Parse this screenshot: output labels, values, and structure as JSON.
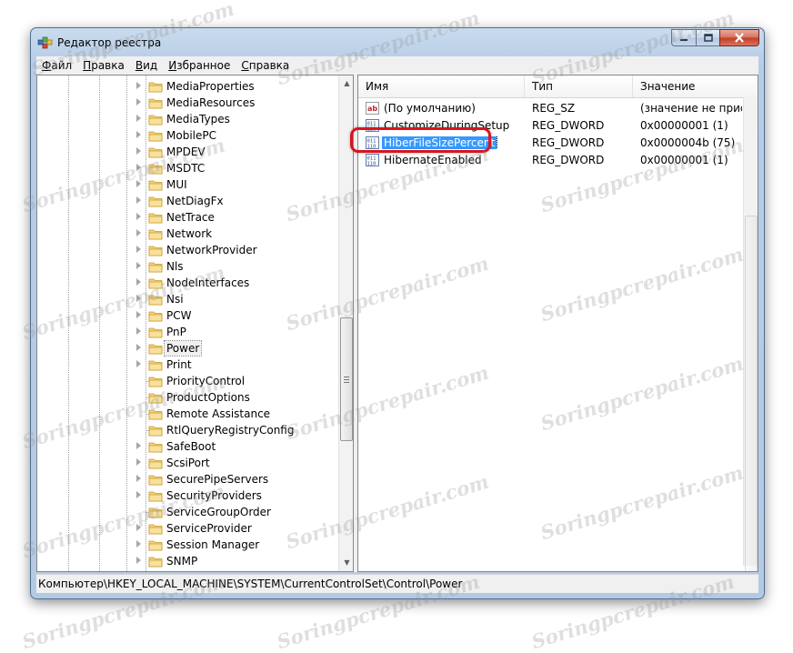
{
  "window": {
    "title": "Редактор реестра",
    "accent_color": "#b4cae3",
    "close_color": "#c43b22"
  },
  "menu": [
    "Файл",
    "Правка",
    "Вид",
    "Избранное",
    "Справка"
  ],
  "tree": {
    "items": [
      {
        "label": "MediaProperties",
        "expandable": true
      },
      {
        "label": "MediaResources",
        "expandable": true
      },
      {
        "label": "MediaTypes",
        "expandable": true
      },
      {
        "label": "MobilePC",
        "expandable": true
      },
      {
        "label": "MPDEV",
        "expandable": true
      },
      {
        "label": "MSDTC",
        "expandable": true
      },
      {
        "label": "MUI",
        "expandable": true
      },
      {
        "label": "NetDiagFx",
        "expandable": true
      },
      {
        "label": "NetTrace",
        "expandable": true
      },
      {
        "label": "Network",
        "expandable": true
      },
      {
        "label": "NetworkProvider",
        "expandable": true
      },
      {
        "label": "Nls",
        "expandable": true
      },
      {
        "label": "NodeInterfaces",
        "expandable": true
      },
      {
        "label": "Nsi",
        "expandable": true
      },
      {
        "label": "PCW",
        "expandable": true
      },
      {
        "label": "PnP",
        "expandable": true
      },
      {
        "label": "Power",
        "expandable": true,
        "selected": true
      },
      {
        "label": "Print",
        "expandable": true
      },
      {
        "label": "PriorityControl",
        "expandable": false
      },
      {
        "label": "ProductOptions",
        "expandable": false
      },
      {
        "label": "Remote Assistance",
        "expandable": false
      },
      {
        "label": "RtlQueryRegistryConfig",
        "expandable": false
      },
      {
        "label": "SafeBoot",
        "expandable": true
      },
      {
        "label": "ScsiPort",
        "expandable": true
      },
      {
        "label": "SecurePipeServers",
        "expandable": true
      },
      {
        "label": "SecurityProviders",
        "expandable": true
      },
      {
        "label": "ServiceGroupOrder",
        "expandable": false
      },
      {
        "label": "ServiceProvider",
        "expandable": true
      },
      {
        "label": "Session Manager",
        "expandable": true
      },
      {
        "label": "SNMP",
        "expandable": true
      }
    ]
  },
  "list": {
    "columns": {
      "name": "Имя",
      "type": "Тип",
      "value": "Значение"
    },
    "rows": [
      {
        "icon": "string-value-icon",
        "name": "(По умолчанию)",
        "type": "REG_SZ",
        "value": "(значение не присвоено)"
      },
      {
        "icon": "dword-value-icon",
        "name": "CustomizeDuringSetup",
        "type": "REG_DWORD",
        "value": "0x00000001 (1)"
      },
      {
        "icon": "dword-value-icon",
        "name": "HiberFileSizePercent",
        "type": "REG_DWORD",
        "value": "0x0000004b (75)",
        "selected": true
      },
      {
        "icon": "dword-value-icon",
        "name": "HibernateEnabled",
        "type": "REG_DWORD",
        "value": "0x00000001 (1)"
      }
    ],
    "highlight_color": "#d9141e",
    "selection_color": "#3399ff"
  },
  "status": {
    "path": "Компьютер\\HKEY_LOCAL_MACHINE\\SYSTEM\\CurrentControlSet\\Control\\Power"
  },
  "watermark": {
    "text": "Soringpcrepair.com"
  }
}
